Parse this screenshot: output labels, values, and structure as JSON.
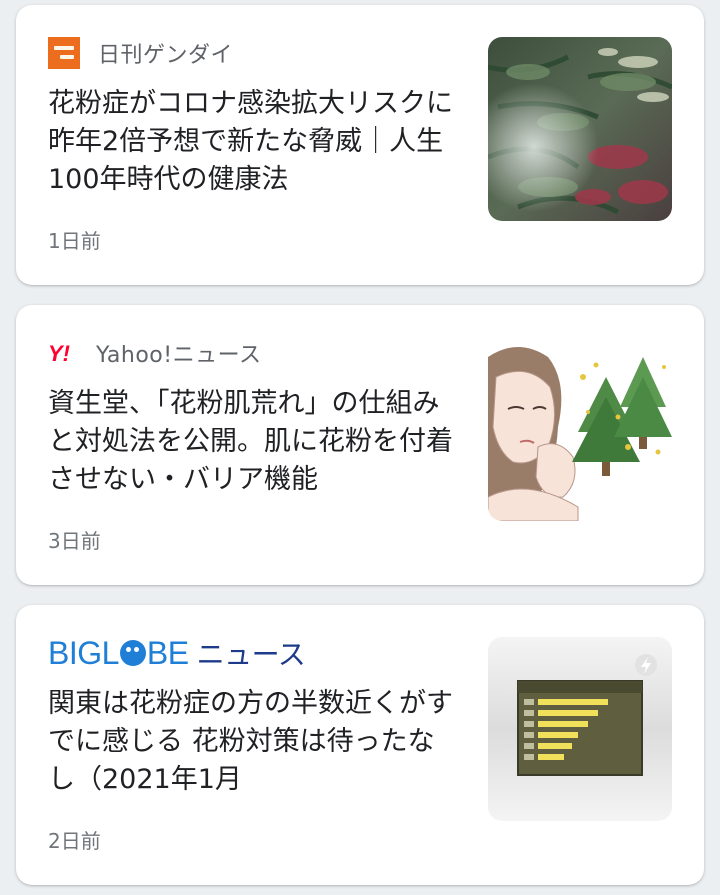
{
  "articles": [
    {
      "source": "日刊ゲンダイ",
      "title": "花粉症がコロナ感染拡大リスクに 昨年2倍予想で新たな脅威｜人生100年時代の健康法",
      "time": "1日前"
    },
    {
      "source": "Yahoo!ニュース",
      "title": "資生堂、「花粉肌荒れ」の仕組みと対処法を公開。肌に花粉を付着させない・バリア機能",
      "time": "3日前"
    },
    {
      "source_logo": {
        "primary": "BIGL",
        "secondary": "BE",
        "suffix": "ニュース"
      },
      "title": "関東は花粉症の方の半数近くがすでに感じる 花粉対策は待ったなし（2021年1月",
      "time": "2日前"
    }
  ],
  "colors": {
    "background": "#eceff1",
    "card": "#ffffff",
    "headline": "#202124",
    "meta": "#70757a",
    "gendai_orange": "#ec6d1d",
    "yahoo_red": "#ff0033",
    "biglobe_blue": "#1f7fd6",
    "biglobe_navy": "#1e3a8a"
  },
  "icons": {
    "gendai": "gendai-logo-icon",
    "yahoo": "yahoo-logo-icon",
    "biglobe": "biglobe-logo-icon",
    "amp": "amp-lightning-icon"
  }
}
